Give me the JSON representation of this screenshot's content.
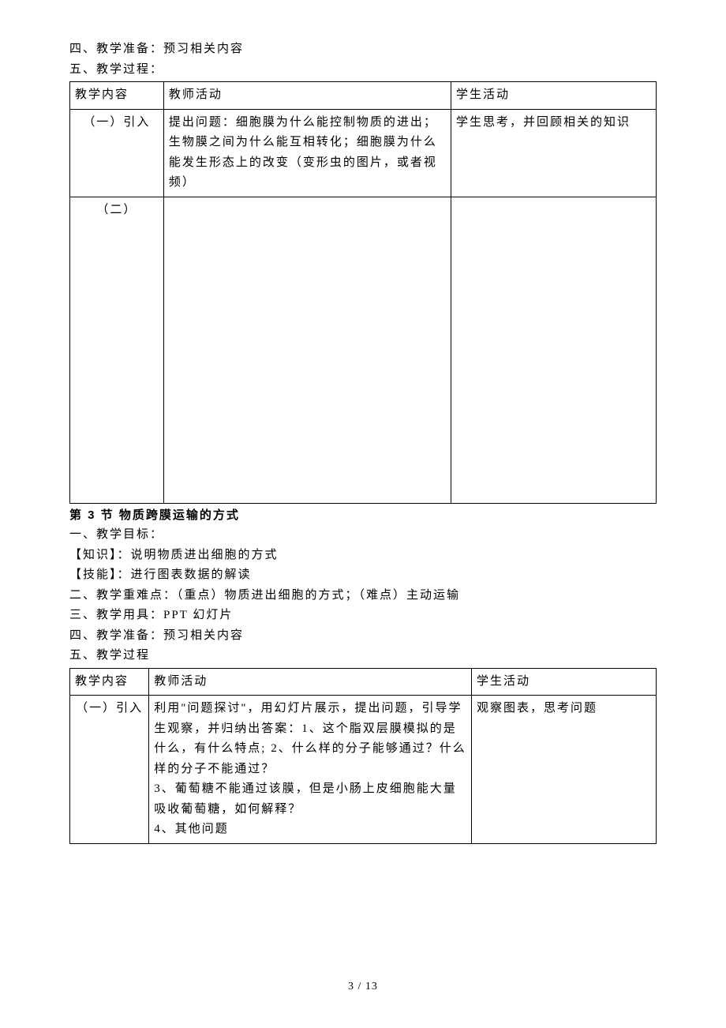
{
  "intro": {
    "line_four": "四、教学准备：预习相关内容",
    "line_five": "五、教学过程："
  },
  "table1": {
    "headers": {
      "c1": "教学内容",
      "c2": "教师活动",
      "c3": "学生活动"
    },
    "rows": [
      {
        "c1": "（一）引入",
        "c2": "提出问题：细胞膜为什么能控制物质的进出；生物膜之间为什么能互相转化；细胞膜为什么能发生形态上的改变（变形虫的图片，或者视频）",
        "c3": "学生思考，并回顾相关的知识"
      },
      {
        "c1": "（二）",
        "c2": "",
        "c3": ""
      }
    ]
  },
  "section3": {
    "title": "第 3 节  物质跨膜运输的方式",
    "line_one": "一、教学目标：",
    "knowledge": "【知识】：说明物质进出细胞的方式",
    "skill": "【技能】：进行图表数据的解读",
    "line_two": "二、教学重难点：（重点）物质进出细胞的方式；（难点）主动运输",
    "line_three": "三、教学用具：PPT 幻灯片",
    "line_four": "四、教学准备：预习相关内容",
    "line_five": "五、教学过程"
  },
  "table2": {
    "headers": {
      "c1": "教学内容",
      "c2": "教师活动",
      "c3": "学生活动"
    },
    "rows": [
      {
        "c1": "（一）引入",
        "c2_l1": "利用\"问题探讨\"，用幻灯片展示，提出问题，引导学生观察，并归纳出答案：1、这个脂双层膜模拟的是什么，有什么特点; 2、什么样的分子能够通过？什么样的分子不能通过？",
        "c2_l2": "3、葡萄糖不能通过该膜，但是小肠上皮细胞能大量吸收葡萄糖，如何解释？",
        "c2_l3": "4、其他问题",
        "c3": "观察图表，思考问题"
      }
    ]
  },
  "footer": "3 / 13"
}
